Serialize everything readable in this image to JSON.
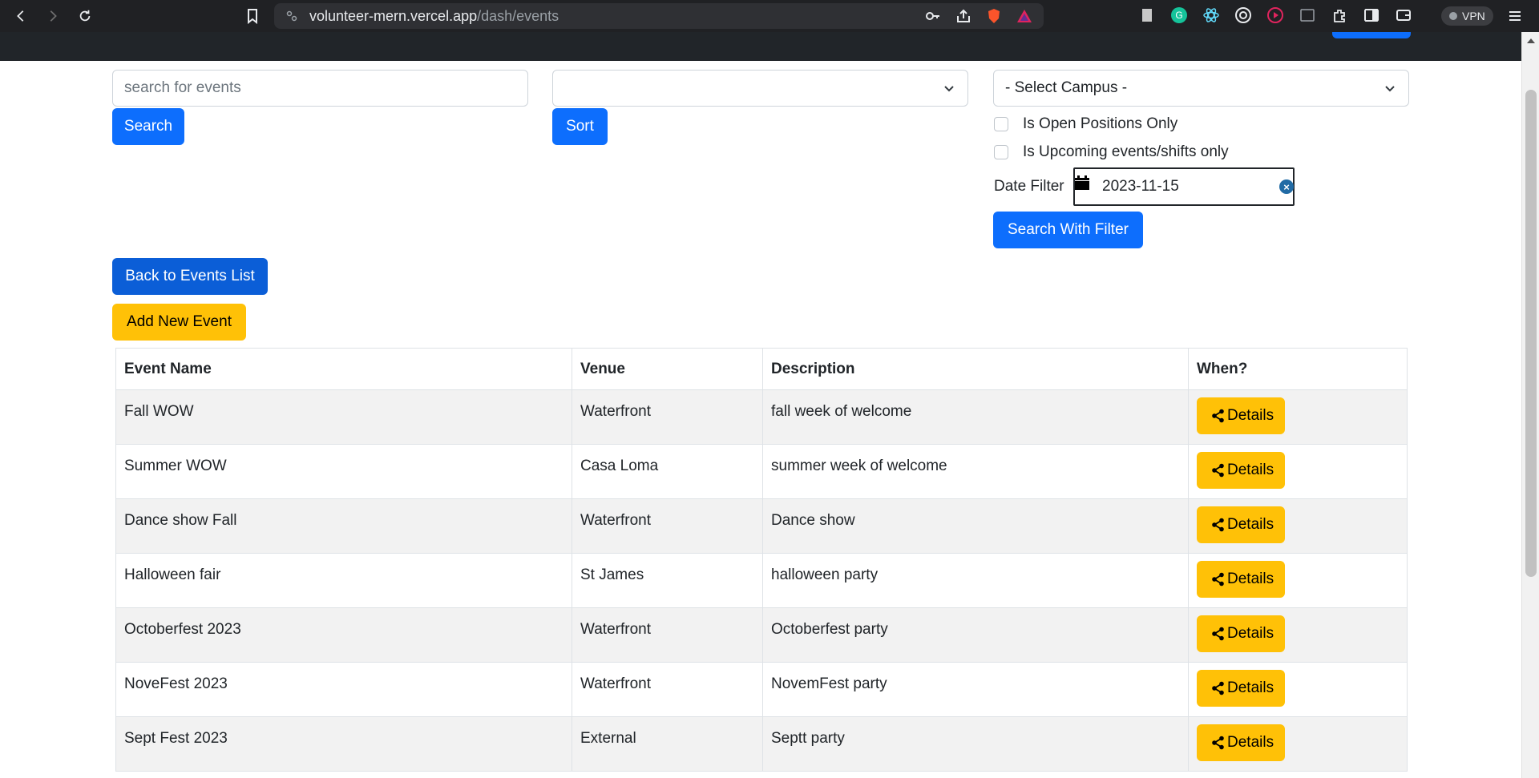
{
  "browser": {
    "url_host": "volunteer-mern.vercel.app",
    "url_path": "/dash/events",
    "vpn_label": "VPN"
  },
  "search": {
    "placeholder": "search for events",
    "search_label": "Search",
    "sort_value": "",
    "sort_label": "Sort"
  },
  "filters": {
    "campus_value": "- Select Campus -",
    "open_positions_label": "Is Open Positions Only",
    "upcoming_label": "Is Upcoming events/shifts only",
    "date_label": "Date Filter",
    "date_value": "2023-11-15",
    "search_with_filter_label": "Search With Filter"
  },
  "actions": {
    "back_label": "Back to Events List",
    "add_label": "Add New Event"
  },
  "table": {
    "headers": [
      "Event Name",
      "Venue",
      "Description",
      "When?"
    ],
    "details_label": "Details",
    "rows": [
      {
        "name": "Fall WOW",
        "venue": "Waterfront",
        "description": "fall week of welcome"
      },
      {
        "name": "Summer WOW",
        "venue": "Casa Loma",
        "description": "summer week of welcome"
      },
      {
        "name": "Dance show Fall",
        "venue": "Waterfront",
        "description": "Dance show"
      },
      {
        "name": "Halloween fair",
        "venue": "St James",
        "description": "halloween party"
      },
      {
        "name": "Octoberfest 2023",
        "venue": "Waterfront",
        "description": "Octoberfest party"
      },
      {
        "name": "NoveFest 2023",
        "venue": "Waterfront",
        "description": "NovemFest party"
      },
      {
        "name": "Sept Fest 2023",
        "venue": "External",
        "description": "Septt party"
      }
    ]
  },
  "colors": {
    "primary": "#0d6efd",
    "warning": "#ffc107",
    "header_dark": "#212529"
  }
}
